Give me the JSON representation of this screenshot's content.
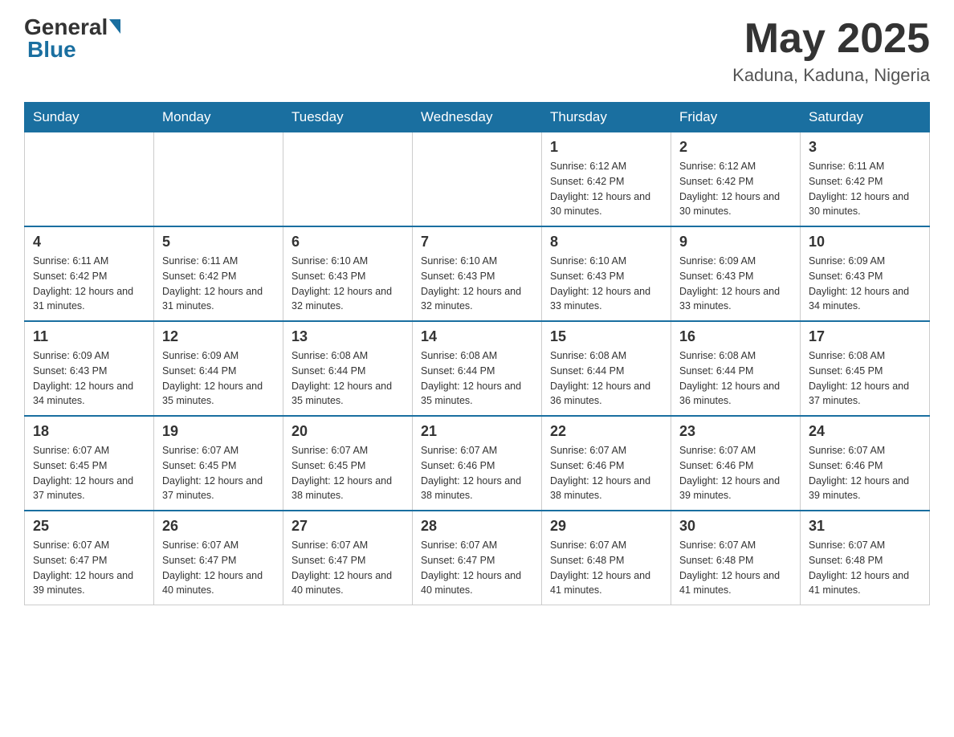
{
  "header": {
    "logo_general": "General",
    "logo_blue": "Blue",
    "month_year": "May 2025",
    "location": "Kaduna, Kaduna, Nigeria"
  },
  "days_of_week": [
    "Sunday",
    "Monday",
    "Tuesday",
    "Wednesday",
    "Thursday",
    "Friday",
    "Saturday"
  ],
  "weeks": [
    [
      {
        "day": "",
        "info": ""
      },
      {
        "day": "",
        "info": ""
      },
      {
        "day": "",
        "info": ""
      },
      {
        "day": "",
        "info": ""
      },
      {
        "day": "1",
        "info": "Sunrise: 6:12 AM\nSunset: 6:42 PM\nDaylight: 12 hours and 30 minutes."
      },
      {
        "day": "2",
        "info": "Sunrise: 6:12 AM\nSunset: 6:42 PM\nDaylight: 12 hours and 30 minutes."
      },
      {
        "day": "3",
        "info": "Sunrise: 6:11 AM\nSunset: 6:42 PM\nDaylight: 12 hours and 30 minutes."
      }
    ],
    [
      {
        "day": "4",
        "info": "Sunrise: 6:11 AM\nSunset: 6:42 PM\nDaylight: 12 hours and 31 minutes."
      },
      {
        "day": "5",
        "info": "Sunrise: 6:11 AM\nSunset: 6:42 PM\nDaylight: 12 hours and 31 minutes."
      },
      {
        "day": "6",
        "info": "Sunrise: 6:10 AM\nSunset: 6:43 PM\nDaylight: 12 hours and 32 minutes."
      },
      {
        "day": "7",
        "info": "Sunrise: 6:10 AM\nSunset: 6:43 PM\nDaylight: 12 hours and 32 minutes."
      },
      {
        "day": "8",
        "info": "Sunrise: 6:10 AM\nSunset: 6:43 PM\nDaylight: 12 hours and 33 minutes."
      },
      {
        "day": "9",
        "info": "Sunrise: 6:09 AM\nSunset: 6:43 PM\nDaylight: 12 hours and 33 minutes."
      },
      {
        "day": "10",
        "info": "Sunrise: 6:09 AM\nSunset: 6:43 PM\nDaylight: 12 hours and 34 minutes."
      }
    ],
    [
      {
        "day": "11",
        "info": "Sunrise: 6:09 AM\nSunset: 6:43 PM\nDaylight: 12 hours and 34 minutes."
      },
      {
        "day": "12",
        "info": "Sunrise: 6:09 AM\nSunset: 6:44 PM\nDaylight: 12 hours and 35 minutes."
      },
      {
        "day": "13",
        "info": "Sunrise: 6:08 AM\nSunset: 6:44 PM\nDaylight: 12 hours and 35 minutes."
      },
      {
        "day": "14",
        "info": "Sunrise: 6:08 AM\nSunset: 6:44 PM\nDaylight: 12 hours and 35 minutes."
      },
      {
        "day": "15",
        "info": "Sunrise: 6:08 AM\nSunset: 6:44 PM\nDaylight: 12 hours and 36 minutes."
      },
      {
        "day": "16",
        "info": "Sunrise: 6:08 AM\nSunset: 6:44 PM\nDaylight: 12 hours and 36 minutes."
      },
      {
        "day": "17",
        "info": "Sunrise: 6:08 AM\nSunset: 6:45 PM\nDaylight: 12 hours and 37 minutes."
      }
    ],
    [
      {
        "day": "18",
        "info": "Sunrise: 6:07 AM\nSunset: 6:45 PM\nDaylight: 12 hours and 37 minutes."
      },
      {
        "day": "19",
        "info": "Sunrise: 6:07 AM\nSunset: 6:45 PM\nDaylight: 12 hours and 37 minutes."
      },
      {
        "day": "20",
        "info": "Sunrise: 6:07 AM\nSunset: 6:45 PM\nDaylight: 12 hours and 38 minutes."
      },
      {
        "day": "21",
        "info": "Sunrise: 6:07 AM\nSunset: 6:46 PM\nDaylight: 12 hours and 38 minutes."
      },
      {
        "day": "22",
        "info": "Sunrise: 6:07 AM\nSunset: 6:46 PM\nDaylight: 12 hours and 38 minutes."
      },
      {
        "day": "23",
        "info": "Sunrise: 6:07 AM\nSunset: 6:46 PM\nDaylight: 12 hours and 39 minutes."
      },
      {
        "day": "24",
        "info": "Sunrise: 6:07 AM\nSunset: 6:46 PM\nDaylight: 12 hours and 39 minutes."
      }
    ],
    [
      {
        "day": "25",
        "info": "Sunrise: 6:07 AM\nSunset: 6:47 PM\nDaylight: 12 hours and 39 minutes."
      },
      {
        "day": "26",
        "info": "Sunrise: 6:07 AM\nSunset: 6:47 PM\nDaylight: 12 hours and 40 minutes."
      },
      {
        "day": "27",
        "info": "Sunrise: 6:07 AM\nSunset: 6:47 PM\nDaylight: 12 hours and 40 minutes."
      },
      {
        "day": "28",
        "info": "Sunrise: 6:07 AM\nSunset: 6:47 PM\nDaylight: 12 hours and 40 minutes."
      },
      {
        "day": "29",
        "info": "Sunrise: 6:07 AM\nSunset: 6:48 PM\nDaylight: 12 hours and 41 minutes."
      },
      {
        "day": "30",
        "info": "Sunrise: 6:07 AM\nSunset: 6:48 PM\nDaylight: 12 hours and 41 minutes."
      },
      {
        "day": "31",
        "info": "Sunrise: 6:07 AM\nSunset: 6:48 PM\nDaylight: 12 hours and 41 minutes."
      }
    ]
  ]
}
